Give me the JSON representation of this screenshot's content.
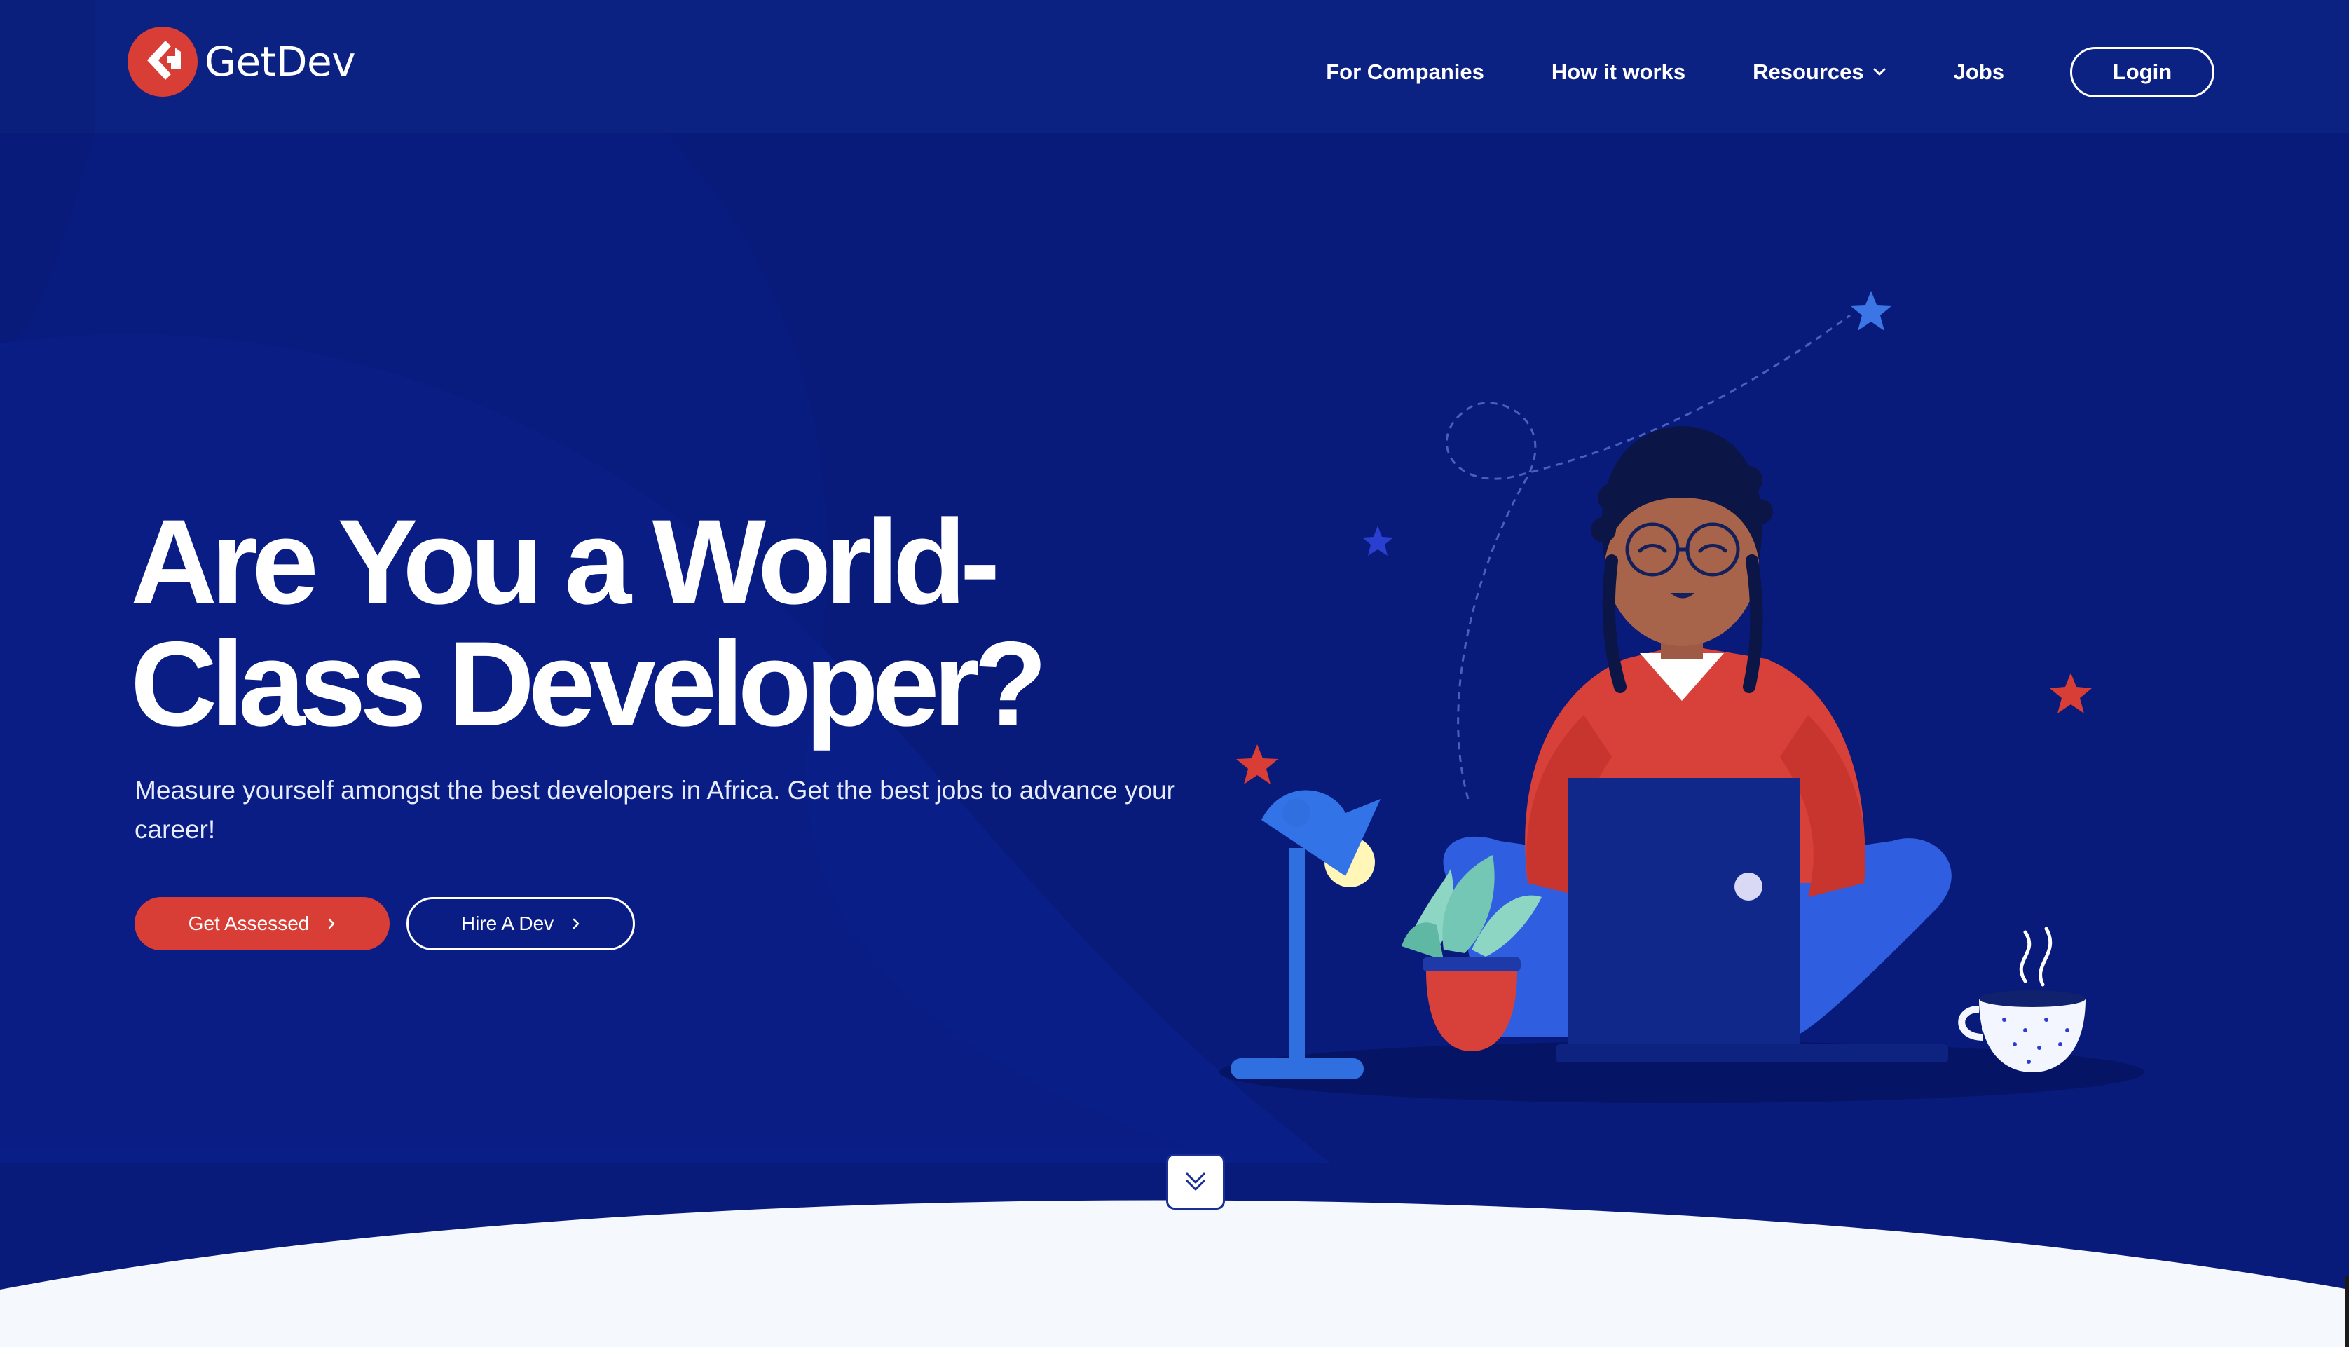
{
  "brand": {
    "name": "GetDev",
    "logo_icon": "getdev-logo-icon",
    "accent_color": "#d83d36",
    "background_color": "#081a7a"
  },
  "nav": {
    "items": [
      {
        "label": "For Companies"
      },
      {
        "label": "How it works"
      },
      {
        "label": "Resources",
        "icon": "chevron-down-icon"
      },
      {
        "label": "Jobs"
      }
    ],
    "login_label": "Login"
  },
  "hero": {
    "title_line1": "Are You a World-",
    "title_line2": "Class Developer?",
    "subtitle": "Measure yourself amongst the best developers in Africa. Get the best jobs to advance your career!",
    "primary_button": "Get Assessed",
    "secondary_button": "Hire A Dev",
    "button_icon": "chevron-right-icon"
  },
  "scroll": {
    "icon": "double-chevron-down-icon"
  }
}
